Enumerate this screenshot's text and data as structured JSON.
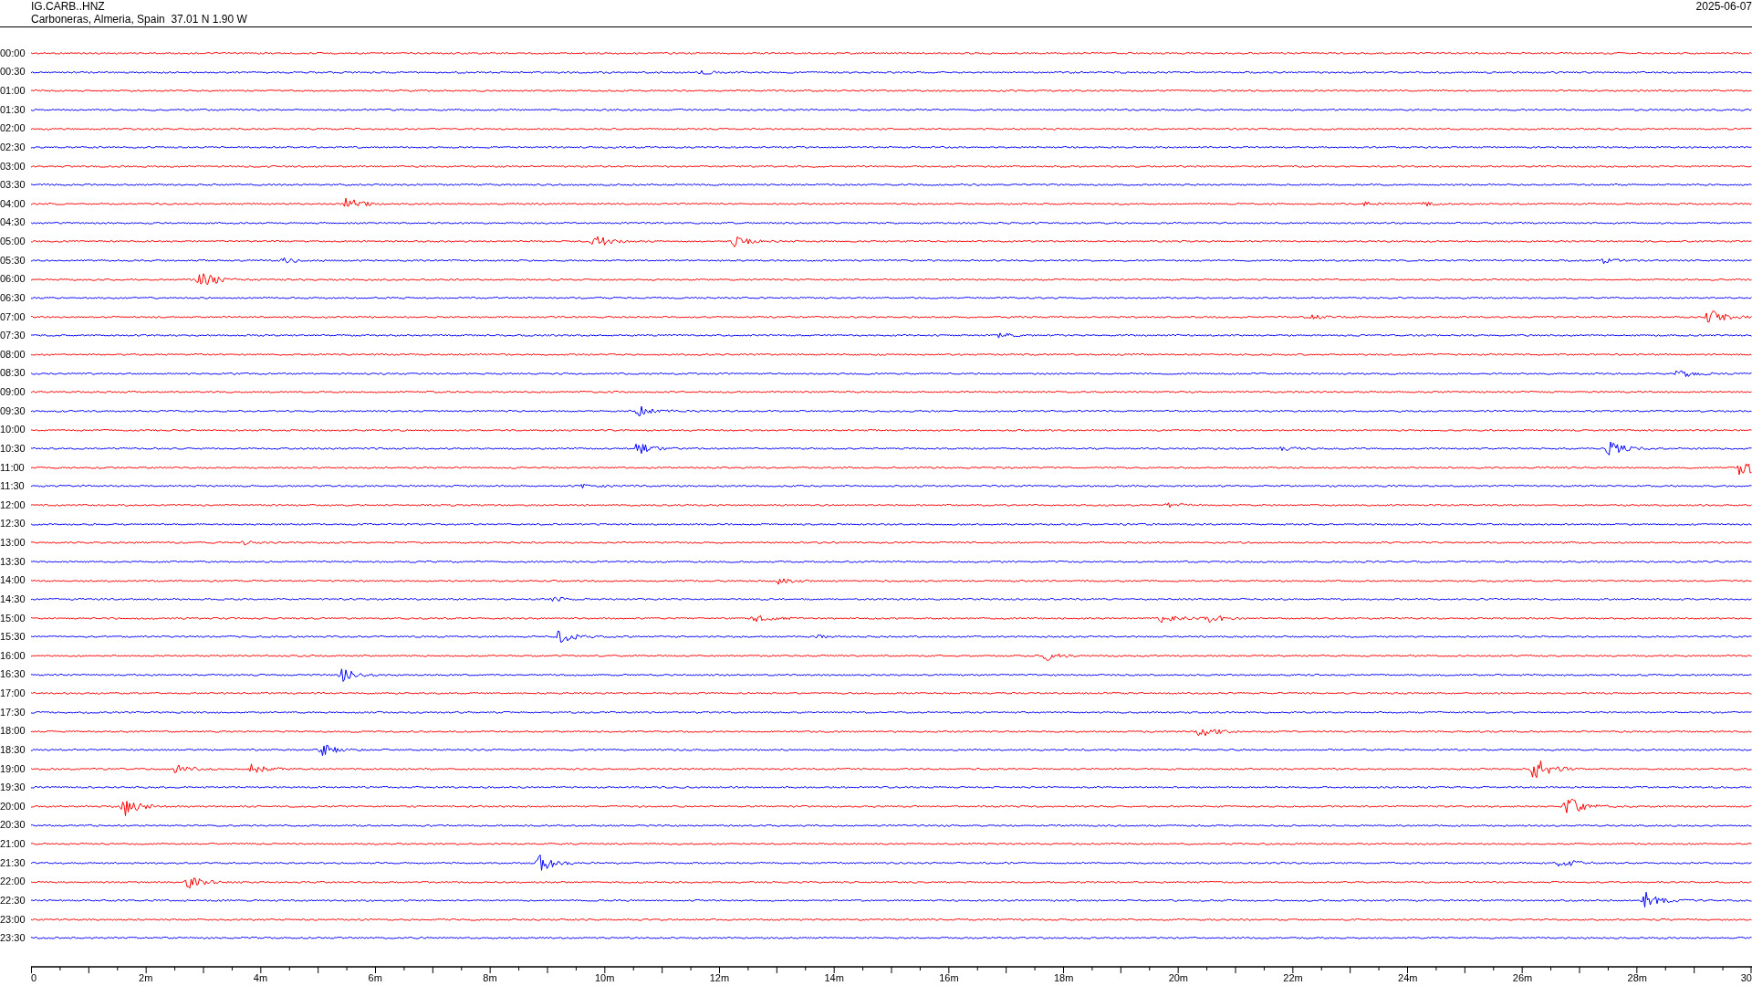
{
  "header": {
    "station": "IG.CARB..HNZ",
    "location": "Carboneras, Almeria, Spain  37.01 N 1.90 W",
    "date": "2025-06-07"
  },
  "rows": [
    {
      "time": "00:00",
      "color": "#ff0000"
    },
    {
      "time": "00:30",
      "color": "#0000ff"
    },
    {
      "time": "01:00",
      "color": "#ff0000"
    },
    {
      "time": "01:30",
      "color": "#0000ff"
    },
    {
      "time": "02:00",
      "color": "#ff0000"
    },
    {
      "time": "02:30",
      "color": "#0000ff"
    },
    {
      "time": "03:00",
      "color": "#ff0000"
    },
    {
      "time": "03:30",
      "color": "#0000ff"
    },
    {
      "time": "04:00",
      "color": "#ff0000"
    },
    {
      "time": "04:30",
      "color": "#0000ff"
    },
    {
      "time": "05:00",
      "color": "#ff0000"
    },
    {
      "time": "05:30",
      "color": "#0000ff"
    },
    {
      "time": "06:00",
      "color": "#ff0000"
    },
    {
      "time": "06:30",
      "color": "#0000ff"
    },
    {
      "time": "07:00",
      "color": "#ff0000"
    },
    {
      "time": "07:30",
      "color": "#0000ff"
    },
    {
      "time": "08:00",
      "color": "#ff0000"
    },
    {
      "time": "08:30",
      "color": "#0000ff"
    },
    {
      "time": "09:00",
      "color": "#ff0000"
    },
    {
      "time": "09:30",
      "color": "#0000ff"
    },
    {
      "time": "10:00",
      "color": "#ff0000"
    },
    {
      "time": "10:30",
      "color": "#0000ff"
    },
    {
      "time": "11:00",
      "color": "#ff0000"
    },
    {
      "time": "11:30",
      "color": "#0000ff"
    },
    {
      "time": "12:00",
      "color": "#ff0000"
    },
    {
      "time": "12:30",
      "color": "#0000ff"
    },
    {
      "time": "13:00",
      "color": "#ff0000"
    },
    {
      "time": "13:30",
      "color": "#0000ff"
    },
    {
      "time": "14:00",
      "color": "#ff0000"
    },
    {
      "time": "14:30",
      "color": "#0000ff"
    },
    {
      "time": "15:00",
      "color": "#ff0000"
    },
    {
      "time": "15:30",
      "color": "#0000ff"
    },
    {
      "time": "16:00",
      "color": "#ff0000"
    },
    {
      "time": "16:30",
      "color": "#0000ff"
    },
    {
      "time": "17:00",
      "color": "#ff0000"
    },
    {
      "time": "17:30",
      "color": "#0000ff"
    },
    {
      "time": "18:00",
      "color": "#ff0000"
    },
    {
      "time": "18:30",
      "color": "#0000ff"
    },
    {
      "time": "19:00",
      "color": "#ff0000"
    },
    {
      "time": "19:30",
      "color": "#0000ff"
    },
    {
      "time": "20:00",
      "color": "#ff0000"
    },
    {
      "time": "20:30",
      "color": "#0000ff"
    },
    {
      "time": "21:00",
      "color": "#ff0000"
    },
    {
      "time": "21:30",
      "color": "#0000ff"
    },
    {
      "time": "22:00",
      "color": "#ff0000"
    },
    {
      "time": "22:30",
      "color": "#0000ff"
    },
    {
      "time": "23:00",
      "color": "#ff0000"
    },
    {
      "time": "23:30",
      "color": "#0000ff"
    }
  ],
  "x_axis": {
    "labels": [
      "0",
      "2m",
      "4m",
      "6m",
      "8m",
      "10m",
      "12m",
      "14m",
      "16m",
      "18m",
      "20m",
      "22m",
      "24m",
      "26m",
      "28m",
      "30"
    ]
  }
}
